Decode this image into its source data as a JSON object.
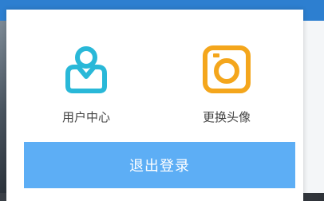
{
  "popup": {
    "actions": [
      {
        "label": "用户中心",
        "icon": "user-center-icon",
        "color": "#29b8d8"
      },
      {
        "label": "更换头像",
        "icon": "change-avatar-icon",
        "color": "#f4a61c"
      }
    ],
    "logout_label": "退出登录"
  },
  "colors": {
    "topbar": "#2d7fd0",
    "logout_button": "#5daef5",
    "text": "#444444"
  }
}
